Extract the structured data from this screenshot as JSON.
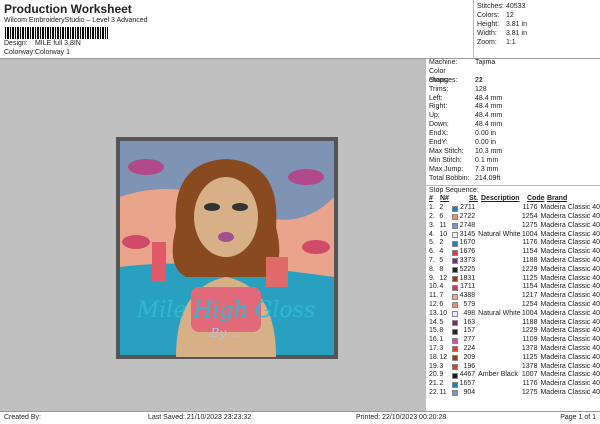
{
  "header": {
    "title": "Production Worksheet",
    "subtitle": "Wilcom EmbroideryStudio – Level 3 Advanced",
    "design_label": "Design:",
    "design_value": "MILE full 3,8IN",
    "colorway_label": "Colorway:",
    "colorway_value": "Colorway 1"
  },
  "stats": [
    {
      "label": "Stitches:",
      "value": "40533"
    },
    {
      "label": "Colors:",
      "value": "12"
    },
    {
      "label": "Height:",
      "value": "3.81 in"
    },
    {
      "label": "Width:",
      "value": "3.81 in"
    },
    {
      "label": "Zoom:",
      "value": "1:1"
    }
  ],
  "info": [
    {
      "label": "Machine:",
      "value": "Tajima"
    },
    {
      "label": "Color changes:",
      "value": "21"
    },
    {
      "label": "Stops:",
      "value": "22"
    },
    {
      "label": "Trims:",
      "value": "128"
    },
    {
      "label": "Left:",
      "value": "48.4 mm"
    },
    {
      "label": "Right:",
      "value": "48.4 mm"
    },
    {
      "label": "Up:",
      "value": "48.4 mm"
    },
    {
      "label": "Down:",
      "value": "48.4 mm"
    },
    {
      "label": "EndX:",
      "value": "0.00 in"
    },
    {
      "label": "EndY:",
      "value": "0.00 in"
    },
    {
      "label": "Max Stitch:",
      "value": "10.3 mm"
    },
    {
      "label": "Min Stitch:",
      "value": "0.1 mm"
    },
    {
      "label": "Max Jump:",
      "value": "7.3 mm"
    },
    {
      "label": "Total Bobbin:",
      "value": "214.09ft"
    }
  ],
  "stop_sequence": {
    "label": "Stop Sequence:",
    "headers": [
      "#",
      "N#",
      "St.",
      "Description",
      "Code",
      "Brand"
    ],
    "rows": [
      [
        "1.",
        "2",
        "#1e7fc0",
        "2711",
        "",
        "1176",
        "Madeira Classic 40"
      ],
      [
        "2.",
        "6",
        "#e8907a",
        "2722",
        "",
        "1254",
        "Madeira Classic 40"
      ],
      [
        "3.",
        "11",
        "#7f93c8",
        "2748",
        "",
        "1275",
        "Madeira Classic 40"
      ],
      [
        "4.",
        "10",
        "#eeeef2",
        "3145",
        "Natural White",
        "1004",
        "Madeira Classic 40"
      ],
      [
        "5.",
        "2",
        "#1e7fc0",
        "1670",
        "",
        "1176",
        "Madeira Classic 40"
      ],
      [
        "6.",
        "4",
        "#e03060",
        "1676",
        "",
        "1154",
        "Madeira Classic 40"
      ],
      [
        "7.",
        "5",
        "#7a2a78",
        "3373",
        "",
        "1188",
        "Madeira Classic 40"
      ],
      [
        "8.",
        "8",
        "#222222",
        "5225",
        "",
        "1229",
        "Madeira Classic 40"
      ],
      [
        "9.",
        "12",
        "#a03a10",
        "1831",
        "",
        "1125",
        "Madeira Classic 40"
      ],
      [
        "10.",
        "4",
        "#e03060",
        "1711",
        "",
        "1154",
        "Madeira Classic 40"
      ],
      [
        "11.",
        "7",
        "#f0a890",
        "4388",
        "",
        "1217",
        "Madeira Classic 40"
      ],
      [
        "12.",
        "6",
        "#e8907a",
        "579",
        "",
        "1254",
        "Madeira Classic 40"
      ],
      [
        "13.",
        "10",
        "#eeeef2",
        "498",
        "Natural White",
        "1004",
        "Madeira Classic 40"
      ],
      [
        "14.",
        "5",
        "#7a2a78",
        "163",
        "",
        "1188",
        "Madeira Classic 40"
      ],
      [
        "15.",
        "8",
        "#222222",
        "157",
        "",
        "1229",
        "Madeira Classic 40"
      ],
      [
        "16.",
        "1",
        "#e04a90",
        "277",
        "",
        "1109",
        "Madeira Classic 40"
      ],
      [
        "17.",
        "3",
        "#e83a2a",
        "224",
        "",
        "1378",
        "Madeira Classic 40"
      ],
      [
        "18.",
        "12",
        "#a03a10",
        "209",
        "",
        "1125",
        "Madeira Classic 40"
      ],
      [
        "19.",
        "3",
        "#e83a2a",
        "196",
        "",
        "1378",
        "Madeira Classic 40"
      ],
      [
        "20.",
        "9",
        "#1a1a1a",
        "4467",
        "Amber Black",
        "1007",
        "Madeira Classic 40"
      ],
      [
        "21.",
        "2",
        "#1e7fc0",
        "1657",
        "",
        "1176",
        "Madeira Classic 40"
      ],
      [
        "22.",
        "11",
        "#7f93c8",
        "904",
        "",
        "1275",
        "Madeira Classic 40"
      ]
    ]
  },
  "footer": {
    "created_by": "Created By:",
    "last_saved": "Last Saved: 21/10/2023 23:23:32",
    "printed": "Printed: 22/10/2023 00:20:28",
    "page": "Page 1 of 1"
  }
}
